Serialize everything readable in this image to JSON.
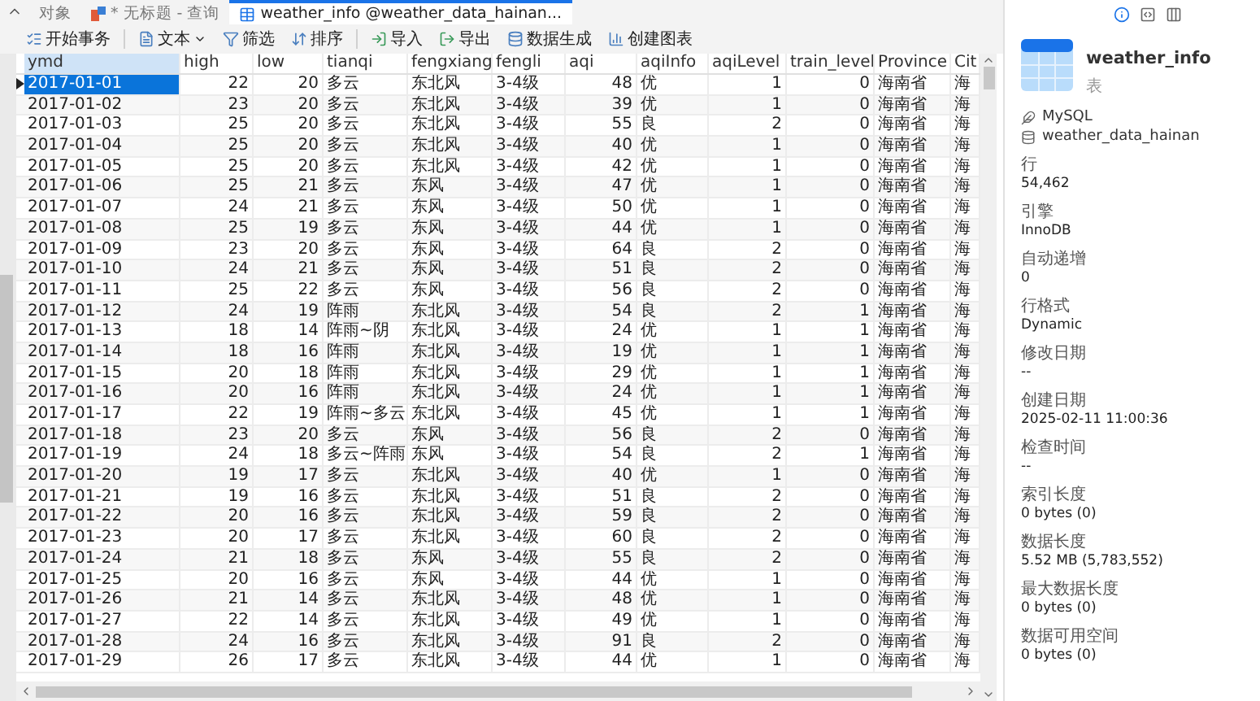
{
  "tabs": [
    {
      "label": "对象",
      "selected": false,
      "kind": "plain"
    },
    {
      "label": "* 无标题 - 查询",
      "selected": false,
      "kind": "query"
    },
    {
      "label": "weather_info @weather_data_hainan...",
      "selected": true,
      "kind": "table"
    }
  ],
  "toolbar": [
    {
      "label": "开始事务",
      "kind": "transaction"
    },
    {
      "label": "文本",
      "kind": "text"
    },
    {
      "label": "筛选",
      "kind": "filter"
    },
    {
      "label": "排序",
      "kind": "sort"
    },
    {
      "label": "导入",
      "kind": "import"
    },
    {
      "label": "导出",
      "kind": "export"
    },
    {
      "label": "数据生成",
      "kind": "generate"
    },
    {
      "label": "创建图表",
      "kind": "chart"
    }
  ],
  "table": {
    "columns": [
      "ymd",
      "high",
      "low",
      "tianqi",
      "fengxiang",
      "fengli",
      "aqi",
      "aqiInfo",
      "aqiLevel",
      "train_level",
      "Province",
      "Cit"
    ],
    "rows": [
      {
        "selected": true,
        "cells": [
          "2017-01-01",
          "22",
          "20",
          "多云",
          "东北风",
          "3-4级",
          "48",
          "优",
          "1",
          "0",
          "海南省",
          "海"
        ]
      },
      {
        "selected": false,
        "cells": [
          "2017-01-02",
          "23",
          "20",
          "多云",
          "东北风",
          "3-4级",
          "39",
          "优",
          "1",
          "0",
          "海南省",
          "海"
        ]
      },
      {
        "selected": false,
        "cells": [
          "2017-01-03",
          "25",
          "20",
          "多云",
          "东北风",
          "3-4级",
          "55",
          "良",
          "2",
          "0",
          "海南省",
          "海"
        ]
      },
      {
        "selected": false,
        "cells": [
          "2017-01-04",
          "25",
          "20",
          "多云",
          "东北风",
          "3-4级",
          "40",
          "优",
          "1",
          "0",
          "海南省",
          "海"
        ]
      },
      {
        "selected": false,
        "cells": [
          "2017-01-05",
          "25",
          "20",
          "多云",
          "东北风",
          "3-4级",
          "42",
          "优",
          "1",
          "0",
          "海南省",
          "海"
        ]
      },
      {
        "selected": false,
        "cells": [
          "2017-01-06",
          "25",
          "21",
          "多云",
          "东风",
          "3-4级",
          "47",
          "优",
          "1",
          "0",
          "海南省",
          "海"
        ]
      },
      {
        "selected": false,
        "cells": [
          "2017-01-07",
          "24",
          "21",
          "多云",
          "东风",
          "3-4级",
          "50",
          "优",
          "1",
          "0",
          "海南省",
          "海"
        ]
      },
      {
        "selected": false,
        "cells": [
          "2017-01-08",
          "25",
          "19",
          "多云",
          "东风",
          "3-4级",
          "44",
          "优",
          "1",
          "0",
          "海南省",
          "海"
        ]
      },
      {
        "selected": false,
        "cells": [
          "2017-01-09",
          "23",
          "20",
          "多云",
          "东风",
          "3-4级",
          "64",
          "良",
          "2",
          "0",
          "海南省",
          "海"
        ]
      },
      {
        "selected": false,
        "cells": [
          "2017-01-10",
          "24",
          "21",
          "多云",
          "东风",
          "3-4级",
          "51",
          "良",
          "2",
          "0",
          "海南省",
          "海"
        ]
      },
      {
        "selected": false,
        "cells": [
          "2017-01-11",
          "25",
          "22",
          "多云",
          "东风",
          "3-4级",
          "56",
          "良",
          "2",
          "0",
          "海南省",
          "海"
        ]
      },
      {
        "selected": false,
        "cells": [
          "2017-01-12",
          "24",
          "19",
          "阵雨",
          "东北风",
          "3-4级",
          "54",
          "良",
          "2",
          "1",
          "海南省",
          "海"
        ]
      },
      {
        "selected": false,
        "cells": [
          "2017-01-13",
          "18",
          "14",
          "阵雨~阴",
          "东北风",
          "3-4级",
          "24",
          "优",
          "1",
          "1",
          "海南省",
          "海"
        ]
      },
      {
        "selected": false,
        "cells": [
          "2017-01-14",
          "18",
          "16",
          "阵雨",
          "东北风",
          "3-4级",
          "19",
          "优",
          "1",
          "1",
          "海南省",
          "海"
        ]
      },
      {
        "selected": false,
        "cells": [
          "2017-01-15",
          "20",
          "18",
          "阵雨",
          "东北风",
          "3-4级",
          "29",
          "优",
          "1",
          "1",
          "海南省",
          "海"
        ]
      },
      {
        "selected": false,
        "cells": [
          "2017-01-16",
          "20",
          "16",
          "阵雨",
          "东北风",
          "3-4级",
          "24",
          "优",
          "1",
          "1",
          "海南省",
          "海"
        ]
      },
      {
        "selected": false,
        "cells": [
          "2017-01-17",
          "22",
          "19",
          "阵雨~多云",
          "东北风",
          "3-4级",
          "45",
          "优",
          "1",
          "1",
          "海南省",
          "海"
        ]
      },
      {
        "selected": false,
        "cells": [
          "2017-01-18",
          "23",
          "20",
          "多云",
          "东风",
          "3-4级",
          "56",
          "良",
          "2",
          "0",
          "海南省",
          "海"
        ]
      },
      {
        "selected": false,
        "cells": [
          "2017-01-19",
          "24",
          "18",
          "多云~阵雨",
          "东风",
          "3-4级",
          "54",
          "良",
          "2",
          "1",
          "海南省",
          "海"
        ]
      },
      {
        "selected": false,
        "cells": [
          "2017-01-20",
          "19",
          "17",
          "多云",
          "东北风",
          "3-4级",
          "40",
          "优",
          "1",
          "0",
          "海南省",
          "海"
        ]
      },
      {
        "selected": false,
        "cells": [
          "2017-01-21",
          "19",
          "16",
          "多云",
          "东北风",
          "3-4级",
          "51",
          "良",
          "2",
          "0",
          "海南省",
          "海"
        ]
      },
      {
        "selected": false,
        "cells": [
          "2017-01-22",
          "20",
          "16",
          "多云",
          "东北风",
          "3-4级",
          "59",
          "良",
          "2",
          "0",
          "海南省",
          "海"
        ]
      },
      {
        "selected": false,
        "cells": [
          "2017-01-23",
          "20",
          "17",
          "多云",
          "东北风",
          "3-4级",
          "60",
          "良",
          "2",
          "0",
          "海南省",
          "海"
        ]
      },
      {
        "selected": false,
        "cells": [
          "2017-01-24",
          "21",
          "18",
          "多云",
          "东风",
          "3-4级",
          "55",
          "良",
          "2",
          "0",
          "海南省",
          "海"
        ]
      },
      {
        "selected": false,
        "cells": [
          "2017-01-25",
          "20",
          "16",
          "多云",
          "东风",
          "3-4级",
          "44",
          "优",
          "1",
          "0",
          "海南省",
          "海"
        ]
      },
      {
        "selected": false,
        "cells": [
          "2017-01-26",
          "21",
          "14",
          "多云",
          "东北风",
          "3-4级",
          "48",
          "优",
          "1",
          "0",
          "海南省",
          "海"
        ]
      },
      {
        "selected": false,
        "cells": [
          "2017-01-27",
          "22",
          "14",
          "多云",
          "东北风",
          "3-4级",
          "49",
          "优",
          "1",
          "0",
          "海南省",
          "海"
        ]
      },
      {
        "selected": false,
        "cells": [
          "2017-01-28",
          "24",
          "16",
          "多云",
          "东北风",
          "3-4级",
          "91",
          "良",
          "2",
          "0",
          "海南省",
          "海"
        ]
      },
      {
        "selected": false,
        "cells": [
          "2017-01-29",
          "26",
          "17",
          "多云",
          "东北风",
          "3-4级",
          "44",
          "优",
          "1",
          "0",
          "海南省",
          "海"
        ]
      }
    ]
  },
  "info_panel": {
    "view_tabs": [
      {
        "kind": "info",
        "selected": true
      },
      {
        "kind": "ddl",
        "selected": false
      },
      {
        "kind": "columns",
        "selected": false
      }
    ],
    "title": "weather_info",
    "subtitle": "表",
    "server": "MySQL",
    "database": "weather_data_hainan",
    "properties": [
      {
        "label": "行",
        "value": "54,462"
      },
      {
        "label": "引擎",
        "value": "InnoDB"
      },
      {
        "label": "自动递增",
        "value": "0"
      },
      {
        "label": "行格式",
        "value": "Dynamic"
      },
      {
        "label": "修改日期",
        "value": "--"
      },
      {
        "label": "创建日期",
        "value": "2025-02-11 11:00:36"
      },
      {
        "label": "检查时间",
        "value": "--"
      },
      {
        "label": "索引长度",
        "value": "0 bytes (0)"
      },
      {
        "label": "数据长度",
        "value": "5.52 MB (5,783,552)"
      },
      {
        "label": "最大数据长度",
        "value": "0 bytes (0)"
      },
      {
        "label": "数据可用空间",
        "value": "0 bytes (0)"
      }
    ]
  }
}
